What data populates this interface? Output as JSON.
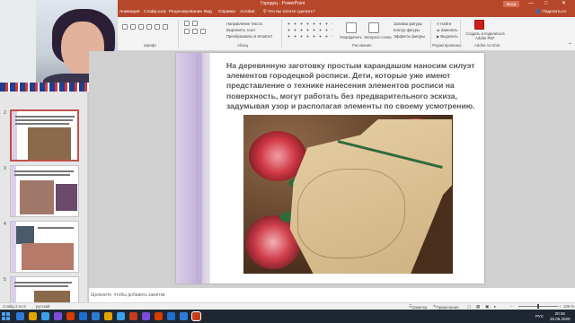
{
  "window": {
    "title": "Городец - PowerPoint",
    "signin_label": "Вход",
    "minimize": "—",
    "maximize": "□",
    "close": "✕"
  },
  "tabs": [
    {
      "label": "Анимация"
    },
    {
      "label": "Слайд-шоу"
    },
    {
      "label": "Рецензирование"
    },
    {
      "label": "Вид"
    },
    {
      "label": "Справка"
    },
    {
      "label": "Acrobat"
    },
    {
      "label": "Что вы хотите сделать?"
    }
  ],
  "share_label": "Поделиться",
  "ribbon": {
    "groups": {
      "font": "Шрифт",
      "paragraph": "Абзац",
      "drawing": "Рисование",
      "editing": "Редактирование",
      "acrobat": "Adobe Acrobat"
    },
    "buttons": {
      "text_direction": "Направление текста",
      "align_text": "Выровнять текст",
      "smartart": "Преобразовать в SmartArt",
      "arrange": "Упорядочить",
      "quick_styles": "Экспресс-стили",
      "shape_fill": "Заливка фигуры",
      "shape_outline": "Контур фигуры",
      "shape_effects": "Эффекты фигуры",
      "find": "Найти",
      "replace": "Заменить",
      "select": "Выделить",
      "create_pdf": "Создать и поделиться Adobe PDF"
    }
  },
  "slides_panel": {
    "numbers": [
      "2",
      "3",
      "4",
      "5"
    ],
    "selected_index": 0
  },
  "slide": {
    "body_text": "На деревянную заготовку простым карандашом наносим силуэт элементов городецкой росписи. Дети, которые уже имеют представление о технике нанесения элементов росписи на поверхность, могут работать без предварительного эскиза, задумывая узор и располагая элементы по своему усмотрению."
  },
  "notes": {
    "placeholder": "Щелкните, чтобы добавить заметки"
  },
  "statusbar": {
    "slide_info": "Слайд 2 из 9",
    "language": "русский",
    "notes_label": "Заметки",
    "comments_label": "Примечания",
    "zoom": "108 %",
    "zoom_fraction": 0.5
  },
  "taskbar": {
    "lang": "РУС",
    "time": "20:46",
    "date": "25.05.2020",
    "app_colors": [
      "#2e7bd6",
      "#e0a400",
      "#3aa0e8",
      "#7d4cdb",
      "#d83b01",
      "#c43e1c",
      "#1f6fd1"
    ]
  },
  "colors": {
    "accent": "#b7472a",
    "slide_sidebar": "#c7b6dc"
  }
}
